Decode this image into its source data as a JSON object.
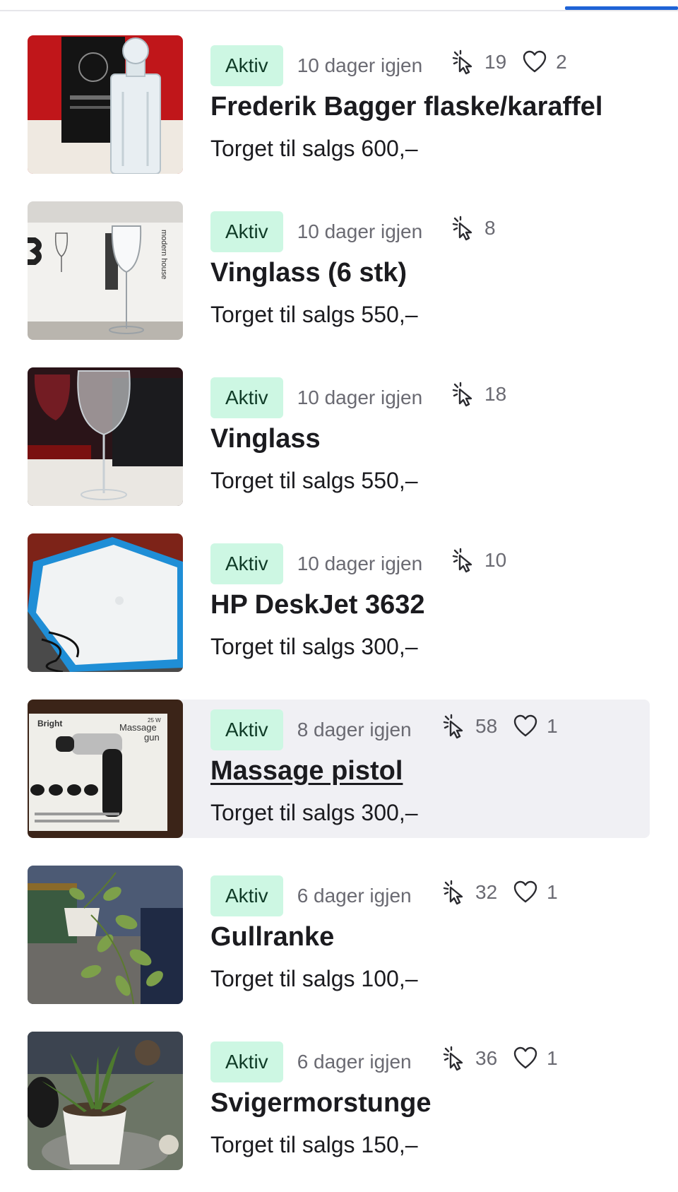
{
  "colors": {
    "badge_bg": "#cdf7e3",
    "badge_text": "#0f3b27",
    "tab_indicator": "#1e63d6",
    "hover_bg": "#f0f0f4",
    "muted_text": "#6a6a72"
  },
  "listings": [
    {
      "status": "Aktiv",
      "remaining": "10 dager igjen",
      "clicks": "19",
      "favorites": "2",
      "title": "Frederik Bagger flaske/karaffel",
      "price": "Torget til salgs 600,–",
      "image": "crystal-decanter-photo"
    },
    {
      "status": "Aktiv",
      "remaining": "10 dager igjen",
      "clicks": "8",
      "favorites": null,
      "title": "Vinglass (6 stk)",
      "price": "Torget til salgs 550,–",
      "image": "wine-glass-box-photo"
    },
    {
      "status": "Aktiv",
      "remaining": "10 dager igjen",
      "clicks": "18",
      "favorites": null,
      "title": "Vinglass",
      "price": "Torget til salgs 550,–",
      "image": "wine-glass-photo"
    },
    {
      "status": "Aktiv",
      "remaining": "10 dager igjen",
      "clicks": "10",
      "favorites": null,
      "title": "HP DeskJet 3632",
      "price": "Torget til salgs 300,–",
      "image": "printer-photo"
    },
    {
      "status": "Aktiv",
      "remaining": "8 dager igjen",
      "clicks": "58",
      "favorites": "1",
      "title": "Massage pistol",
      "price": "Torget til salgs 300,–",
      "image": "massage-gun-box-photo",
      "image_text": {
        "brand": "Bright",
        "power": "25 W",
        "product": "Massage",
        "product2": "gun"
      },
      "hovered": true
    },
    {
      "status": "Aktiv",
      "remaining": "6 dager igjen",
      "clicks": "32",
      "favorites": "1",
      "title": "Gullranke",
      "price": "Torget til salgs 100,–",
      "image": "pothos-plant-photo"
    },
    {
      "status": "Aktiv",
      "remaining": "6 dager igjen",
      "clicks": "36",
      "favorites": "1",
      "title": "Svigermorstunge",
      "price": "Torget til salgs 150,–",
      "image": "snake-plant-photo"
    }
  ]
}
